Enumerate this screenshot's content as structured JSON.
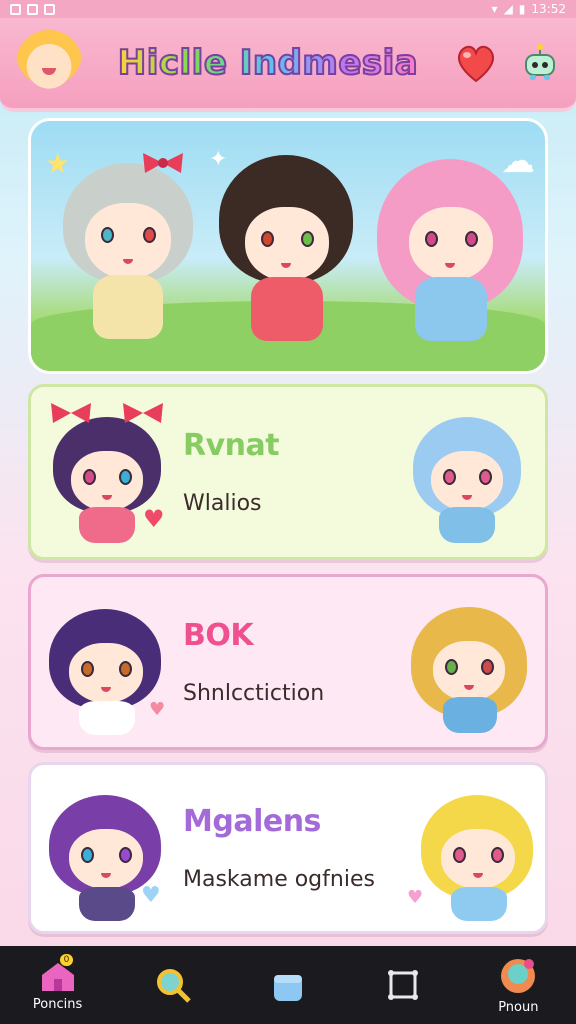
{
  "status_bar": {
    "time": "13:52"
  },
  "header": {
    "title": "Hiclle Indmesia",
    "heart_icon": "heart-icon",
    "robot_icon": "robot-icon",
    "mascot_icon": "mascot-avatar"
  },
  "cards": [
    {
      "title": "Rvnat",
      "subtitle": "Wlalios"
    },
    {
      "title": "BOK",
      "subtitle": "Shnlcctiction"
    },
    {
      "title": "Mgalens",
      "subtitle": "Maskame ogfnies"
    }
  ],
  "nav": [
    {
      "label": "Poncins",
      "icon": "home-icon",
      "badge": "0"
    },
    {
      "label": "",
      "icon": "search-icon"
    },
    {
      "label": "",
      "icon": "bag-icon"
    },
    {
      "label": "",
      "icon": "frame-icon"
    },
    {
      "label": "Pnoun",
      "icon": "profile-icon"
    }
  ],
  "colors": {
    "header": "#f59fbf",
    "accent_pink": "#f0508f",
    "accent_green": "#86cc63",
    "accent_purple": "#a36ad8",
    "nav_bg": "#1b1b1f"
  }
}
